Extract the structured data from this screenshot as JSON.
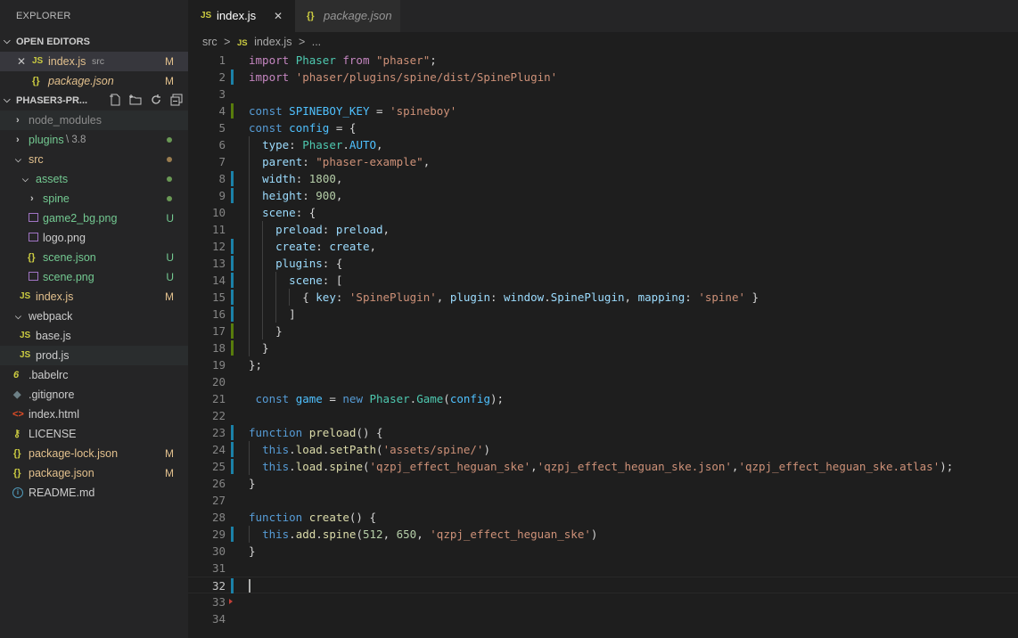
{
  "sidebar": {
    "title": "EXPLORER",
    "open_editors": {
      "label": "OPEN EDITORS",
      "items": [
        {
          "close": "✕",
          "icon": "JS",
          "name": "index.js",
          "desc": "src",
          "badge": "M"
        },
        {
          "icon": "{}",
          "name": "package.json",
          "badge": "M"
        }
      ]
    },
    "project": {
      "label": "PHASER3-PR...",
      "tree": [
        {
          "name": "node_modules"
        },
        {
          "name": "plugins",
          "desc": "\\ 3.8"
        },
        {
          "name": "src"
        },
        {
          "name": "assets"
        },
        {
          "name": "spine"
        },
        {
          "name": "game2_bg.png",
          "badge": "U"
        },
        {
          "name": "logo.png"
        },
        {
          "name": "scene.json",
          "badge": "U"
        },
        {
          "name": "scene.png",
          "badge": "U"
        },
        {
          "name": "index.js",
          "badge": "M"
        },
        {
          "name": "webpack"
        },
        {
          "name": "base.js"
        },
        {
          "name": "prod.js"
        },
        {
          "name": ".babelrc"
        },
        {
          "name": ".gitignore"
        },
        {
          "name": "index.html"
        },
        {
          "name": "LICENSE"
        },
        {
          "name": "package-lock.json",
          "badge": "M"
        },
        {
          "name": "package.json",
          "badge": "M"
        },
        {
          "name": "README.md"
        }
      ]
    }
  },
  "tabs": [
    {
      "icon": "JS",
      "label": "index.js",
      "close": "✕"
    },
    {
      "icon": "{}",
      "label": "package.json"
    }
  ],
  "breadcrumb": {
    "folder": "src",
    "sep": ">",
    "icon": "JS",
    "file": "index.js",
    "more": "..."
  },
  "code_lines": [
    "import Phaser from \"phaser\";",
    "import 'phaser/plugins/spine/dist/SpinePlugin'",
    "",
    "const SPINEBOY_KEY = 'spineboy'",
    "const config = {",
    "  type: Phaser.AUTO,",
    "  parent: \"phaser-example\",",
    "  width: 1800,",
    "  height: 900,",
    "  scene: {",
    "    preload: preload,",
    "    create: create,",
    "    plugins: {",
    "      scene: [",
    "        { key: 'SpinePlugin', plugin: window.SpinePlugin, mapping: 'spine' }",
    "      ]",
    "    }",
    "  }",
    "};",
    "",
    " const game = new Phaser.Game(config);",
    "",
    "function preload() {",
    "  this.load.setPath('assets/spine/')",
    "  this.load.spine('qzpj_effect_heguan_ske','qzpj_effect_heguan_ske.json','qzpj_effect_heguan_ske.atlas');",
    "}",
    "",
    "function create() {",
    "  this.add.spine(512, 650, 'qzpj_effect_heguan_ske')",
    "}",
    "",
    "",
    "",
    ""
  ],
  "colors": {
    "modified": "#e2c08d",
    "untracked": "#73c991",
    "folder_dot": "#6a9955",
    "gutter_modified": "#1b81a8",
    "gutter_added": "#587c0c"
  }
}
